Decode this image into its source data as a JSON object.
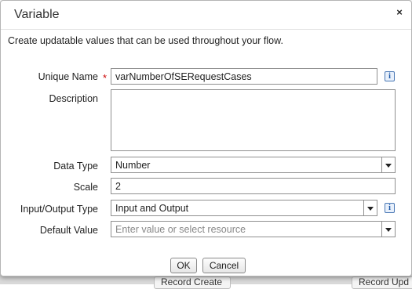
{
  "dialog": {
    "title": "Variable",
    "close_symbol": "×",
    "description": "Create updatable values that can be used throughout your flow."
  },
  "form": {
    "unique_name": {
      "label": "Unique Name",
      "required_mark": "*",
      "value": "varNumberOfSERequestCases",
      "info": "i"
    },
    "description": {
      "label": "Description",
      "value": ""
    },
    "data_type": {
      "label": "Data Type",
      "value": "Number"
    },
    "scale": {
      "label": "Scale",
      "value": "2"
    },
    "io_type": {
      "label": "Input/Output Type",
      "value": "Input and Output",
      "info": "i"
    },
    "default_value": {
      "label": "Default Value",
      "placeholder": "Enter value or select resource"
    }
  },
  "buttons": {
    "ok": "OK",
    "cancel": "Cancel"
  },
  "background": {
    "left_card": "Record Create",
    "right_card": "Record Upd"
  },
  "colors": {
    "required": "#cc0000",
    "info_accent": "#1a56a8"
  }
}
